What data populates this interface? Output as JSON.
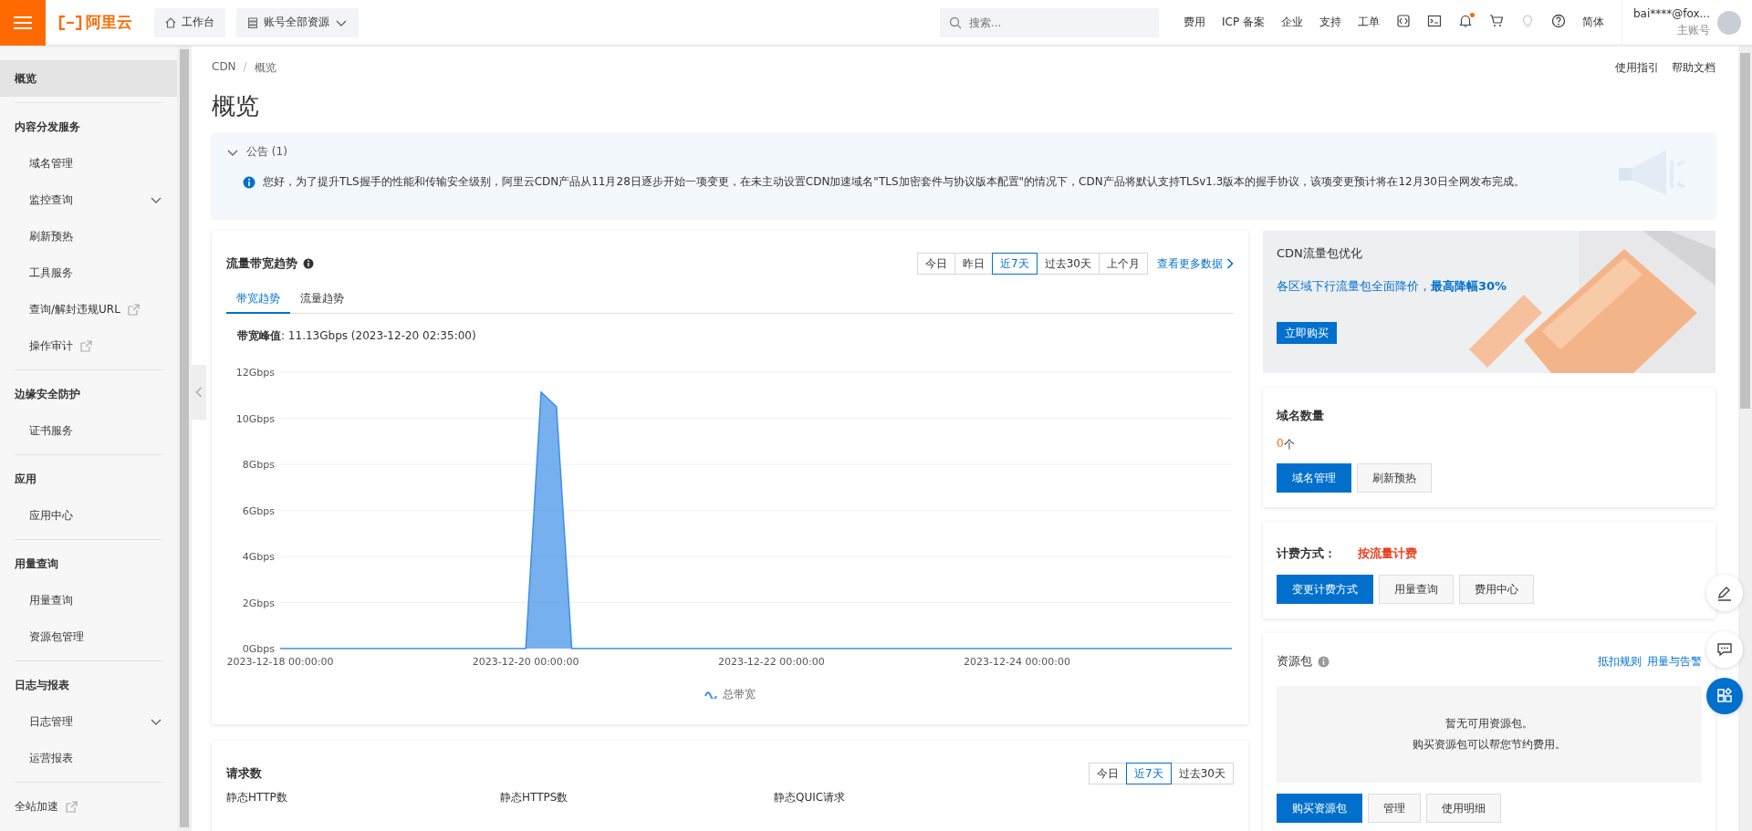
{
  "topbar": {
    "logo": "阿里云",
    "workbench": "工作台",
    "resource_selector": "账号全部资源",
    "search": {
      "placeholder": "搜索..."
    },
    "links": [
      "费用",
      "ICP 备案",
      "企业",
      "支持",
      "工单"
    ],
    "bell_unread": true,
    "language": "简体",
    "account": {
      "name": "bai****@fox...",
      "role": "主账号"
    }
  },
  "sidebar": {
    "items": [
      {
        "kind": "item",
        "label": "概览",
        "selected": true
      },
      {
        "kind": "group",
        "label": "内容分发服务",
        "children": [
          {
            "kind": "item",
            "label": "域名管理",
            "selected": false
          },
          {
            "kind": "submenu",
            "label": "监控查询",
            "selected": false,
            "expanded": false
          },
          {
            "kind": "item",
            "label": "刷新预热",
            "selected": false
          },
          {
            "kind": "item",
            "label": "工具服务",
            "selected": false
          },
          {
            "kind": "external",
            "label": "查询/解封违规URL",
            "selected": false
          },
          {
            "kind": "external",
            "label": "操作审计",
            "selected": false
          }
        ]
      },
      {
        "kind": "group",
        "label": "边缘安全防护",
        "children": [
          {
            "kind": "item",
            "label": "证书服务",
            "selected": false
          }
        ]
      },
      {
        "kind": "group",
        "label": "应用",
        "children": [
          {
            "kind": "item",
            "label": "应用中心",
            "selected": false
          }
        ]
      },
      {
        "kind": "group",
        "label": "用量查询",
        "children": [
          {
            "kind": "item",
            "label": "用量查询",
            "selected": false
          },
          {
            "kind": "item",
            "label": "资源包管理",
            "selected": false
          }
        ]
      },
      {
        "kind": "group",
        "label": "日志与报表",
        "children": [
          {
            "kind": "submenu",
            "label": "日志管理",
            "selected": false,
            "expanded": false
          },
          {
            "kind": "item",
            "label": "运营报表",
            "selected": false
          }
        ]
      },
      {
        "kind": "external",
        "label": "全站加速",
        "selected": false
      }
    ]
  },
  "breadcrumb": [
    "CDN",
    "概览"
  ],
  "breadcrumb_separator": "/",
  "help_links": [
    "使用指引",
    "帮助文档"
  ],
  "page_title": "概览",
  "notice": {
    "title": "公告 (1)",
    "expanded": true,
    "message": "您好，为了提升TLS握手的性能和传输安全级别，阿里云CDN产品从11月28日逐步开始一项变更，在未主动设置CDN加速域名\"TLS加密套件与协议版本配置\"的情况下，CDN产品将默认支持TLSv1.3版本的握手协议，该项变更预计将在12月30日全网发布完成。"
  },
  "traffic": {
    "title": "流量带宽趋势",
    "ranges": [
      {
        "label": "今日",
        "selected": false
      },
      {
        "label": "昨日",
        "selected": false
      },
      {
        "label": "近7天",
        "selected": true
      },
      {
        "label": "过去30天",
        "selected": false
      },
      {
        "label": "上个月",
        "selected": false
      }
    ],
    "more_link": "查看更多数据",
    "tabs": [
      {
        "label": "带宽趋势",
        "selected": true
      },
      {
        "label": "流量趋势",
        "selected": false
      }
    ],
    "peak": "**带宽峰值**: 11.13Gbps (2023-12-20 02:35:00)",
    "chart_data": {
      "type": "area",
      "categories": [
        "2023-12-18 00:00:00",
        null,
        null,
        null,
        null,
        null,
        null,
        null,
        null,
        null,
        null,
        null,
        null,
        null,
        null,
        null,
        "2023-12-20 00:00:00",
        null,
        null,
        null,
        null,
        null,
        null,
        null,
        null,
        null,
        null,
        null,
        null,
        null,
        null,
        null,
        "2023-12-22 00:00:00",
        null,
        null,
        null,
        null,
        null,
        null,
        null,
        null,
        null,
        null,
        null,
        null,
        null,
        null,
        null,
        "2023-12-24 00:00:00",
        null,
        null,
        null,
        null,
        null,
        null,
        null,
        null,
        null,
        null,
        null,
        null,
        null,
        null
      ],
      "series": [
        {
          "name": "总带宽",
          "color": "#3d8fe8",
          "values": [
            0,
            0,
            0,
            0,
            0,
            0,
            0,
            0,
            0,
            0,
            0,
            0,
            0,
            0,
            0,
            0,
            0,
            11.13,
            10.5,
            0,
            0,
            0,
            0,
            0,
            0,
            0,
            0,
            0,
            0,
            0,
            0,
            0,
            0,
            0,
            0,
            0,
            0,
            0,
            0,
            0,
            0,
            0,
            0,
            0,
            0,
            0,
            0,
            0,
            0,
            0,
            0,
            0,
            0,
            0,
            0,
            0,
            0,
            0,
            0,
            0,
            0,
            0,
            0
          ]
        }
      ],
      "ylim": [
        0,
        12
      ],
      "grid": true,
      "yticks": [
        {
          "value": 0,
          "label": "0Gbps"
        },
        {
          "value": 2,
          "label": "2Gbps"
        },
        {
          "value": 4,
          "label": "4Gbps"
        },
        {
          "value": 6,
          "label": "6Gbps"
        },
        {
          "value": 8,
          "label": "8Gbps"
        },
        {
          "value": 10,
          "label": "10Gbps"
        },
        {
          "value": 12,
          "label": "12Gbps"
        }
      ]
    }
  },
  "promo": {
    "title": "CDN流量包优化",
    "text": "各区域下行流量包全面降价，**最高降幅30%**",
    "button": "立即购买"
  },
  "domains": {
    "title": "域名数量",
    "count": "0",
    "unit": "个",
    "buttons": [
      {
        "label": "域名管理",
        "primary": true
      },
      {
        "label": "刷新预热",
        "primary": false
      }
    ]
  },
  "billing": {
    "label": "计费方式：",
    "value": "按流量计费",
    "buttons": [
      {
        "label": "变更计费方式",
        "primary": true
      },
      {
        "label": "用量查询",
        "primary": false
      },
      {
        "label": "费用中心",
        "primary": false
      }
    ]
  },
  "packages": {
    "title": "资源包",
    "links": [
      "抵扣规则",
      "用量与告警"
    ],
    "empty": [
      "暂无可用资源包。",
      "购买资源包可以帮您节约费用。"
    ],
    "buttons": [
      {
        "label": "购买资源包",
        "primary": true
      },
      {
        "label": "管理",
        "primary": false
      },
      {
        "label": "使用明细",
        "primary": false
      }
    ]
  },
  "requests": {
    "title": "请求数",
    "ranges": [
      {
        "label": "今日",
        "selected": false
      },
      {
        "label": "近7天",
        "selected": true
      },
      {
        "label": "过去30天",
        "selected": false
      }
    ],
    "metrics": [
      "静态HTTP数",
      "静态HTTPS数",
      "静态QUIC请求"
    ]
  }
}
